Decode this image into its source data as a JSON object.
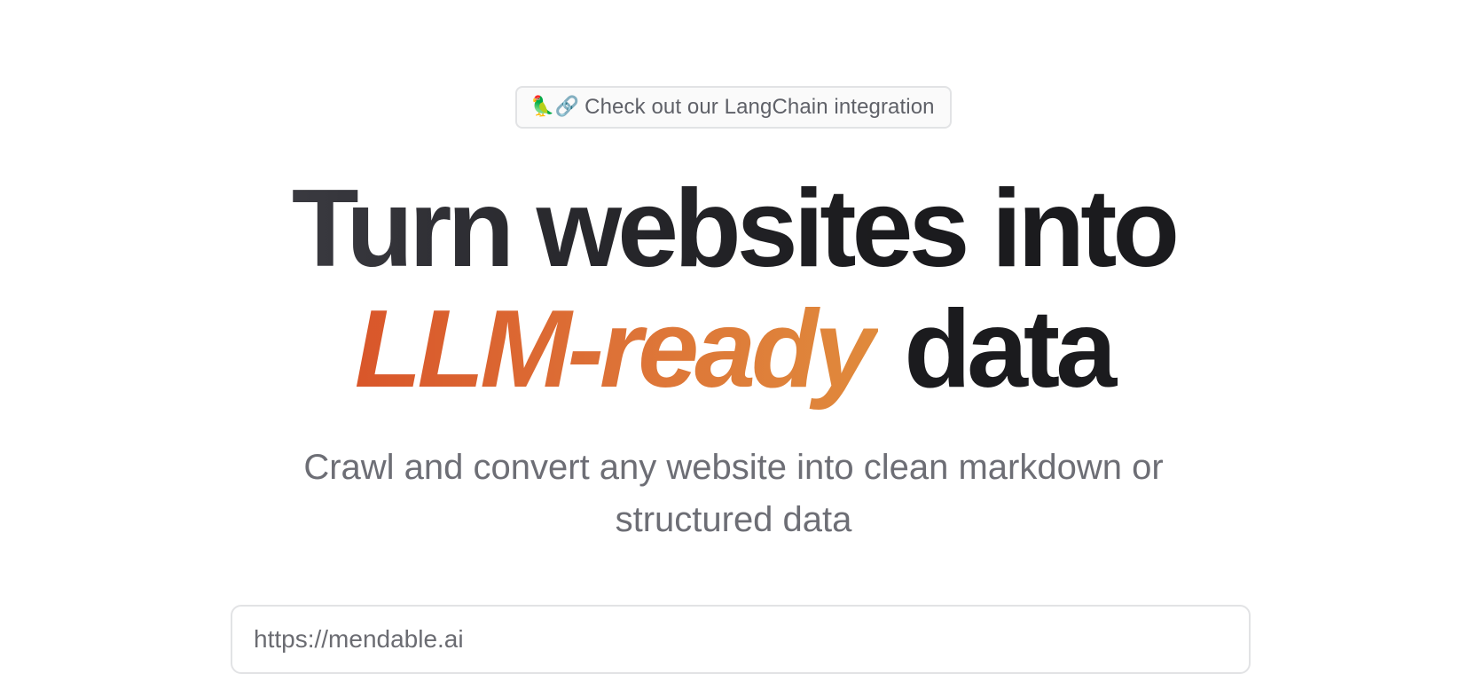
{
  "announcement": {
    "emoji": "🦜🔗",
    "text": "Check out our LangChain integration"
  },
  "hero": {
    "line1": "Turn websites into",
    "accent": "LLM-ready",
    "line2_rest": "data",
    "subtitle": "Crawl and convert any website into clean markdown or structured data"
  },
  "url_input": {
    "placeholder": "https://mendable.ai",
    "value": ""
  },
  "colors": {
    "accent_start": "#d9562a",
    "accent_end": "#e08a3c",
    "heading": "#1b1b1e",
    "muted_text": "#6d6e75",
    "border": "#e2e3e5"
  }
}
